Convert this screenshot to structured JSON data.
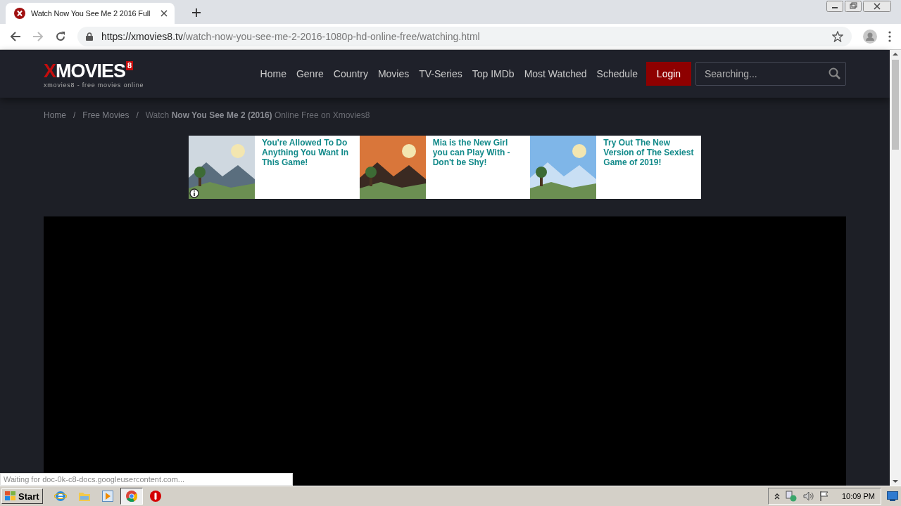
{
  "browser": {
    "tab_title": "Watch Now You See Me 2 2016 Full",
    "url_host": "https://xmovies8.tv",
    "url_path": "/watch-now-you-see-me-2-2016-1080p-hd-online-free/watching.html"
  },
  "header": {
    "logo_first": "X",
    "logo_rest": "MOVIES",
    "logo_badge": "8",
    "tagline": "xmovies8 - free movies online",
    "nav": [
      "Home",
      "Genre",
      "Country",
      "Movies",
      "TV-Series",
      "Top IMDb",
      "Most Watched",
      "Schedule"
    ],
    "login": "Login",
    "search": {
      "placeholder": "Searching..."
    }
  },
  "breadcrumb_separator": "/",
  "breadcrumb": [
    "Home",
    "Free Movies",
    "Watch **Now You See Me 2 (2016)** Online Free on Xmovies8"
  ],
  "ads": [
    {
      "kind": "picture",
      "text": "You're Allowed To Do Anything You Want In This Game!"
    },
    {
      "kind": "picture",
      "text": "Mia is the New Girl you can Play With - Don't be Shy!"
    },
    {
      "kind": "picture",
      "text": "Try Out The New Version of The Sexiest Game of 2019!"
    }
  ],
  "status_text": "Waiting for doc-0k-c8-docs.googleusercontent.com...",
  "taskbar": {
    "start": "Start",
    "clock": "10:09 PM"
  }
}
